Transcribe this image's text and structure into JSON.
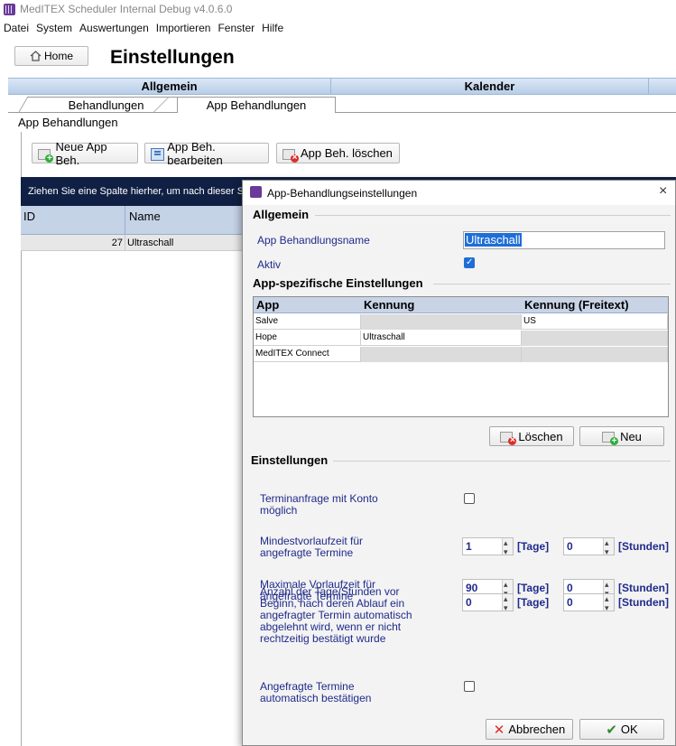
{
  "window": {
    "title": "MedITEX Scheduler Internal Debug v4.0.6.0",
    "icon": "calendar-app-icon"
  },
  "menu": [
    "Datei",
    "System",
    "Auswertungen",
    "Importieren",
    "Fenster",
    "Hilfe"
  ],
  "header": {
    "home_label": "Home",
    "page_title": "Einstellungen"
  },
  "main_tabs": [
    "Allgemein",
    "Kalender"
  ],
  "sub_tabs": [
    "Behandlungen",
    "App Behandlungen"
  ],
  "section_label": "App Behandlungen",
  "toolbar": {
    "new": "Neue App Beh.",
    "edit": "App Beh. bearbeiten",
    "delete": "App Beh. löschen"
  },
  "grid": {
    "group_hint": "Ziehen Sie eine Spalte hierher, um nach dieser Spalte",
    "columns": [
      "ID",
      "Name"
    ],
    "rows": [
      {
        "id": "27",
        "name": "Ultraschall"
      }
    ]
  },
  "dialog": {
    "title": "App-Behandlungseinstellungen",
    "close": "×",
    "allgemein": {
      "title": "Allgemein",
      "name_label": "App Behandlungsname",
      "name_value": "Ultraschall",
      "active_label": "Aktiv",
      "active_checked": true
    },
    "app_settings": {
      "title": "App-spezifische Einstellungen",
      "columns": [
        "App",
        "Kennung",
        "Kennung (Freitext)"
      ],
      "rows": [
        {
          "app": "Salve",
          "kennung": "",
          "freitext": "US"
        },
        {
          "app": "Hope",
          "kennung": "Ultraschall",
          "freitext": ""
        },
        {
          "app": "MedITEX Connect",
          "kennung": "",
          "freitext": ""
        }
      ],
      "delete_label": "Löschen",
      "new_label": "Neu"
    },
    "settings": {
      "title": "Einstellungen",
      "request_with_account": {
        "label": "Terminanfrage mit Konto möglich",
        "checked": false
      },
      "min_lead": {
        "label": "Mindestvorlaufzeit für angefragte Termine",
        "days": "1",
        "hours": "0"
      },
      "max_lead": {
        "label": "Maximale Vorlaufzeit für angefragte Termine",
        "days": "90",
        "hours": "0"
      },
      "auto_reject": {
        "label": "Anzahl der Tage/Stunden vor Beginn, nach deren Ablauf ein angefragter Termin automatisch abgelehnt wird, wenn er nicht rechtzeitig bestätigt wurde",
        "days": "0",
        "hours": "0"
      },
      "auto_confirm": {
        "label": "Angefragte Termine automatisch bestätigen",
        "checked": false
      },
      "unit_days": "[Tage]",
      "unit_hours": "[Stunden]"
    },
    "cancel_label": "Abbrechen",
    "ok_label": "OK"
  }
}
